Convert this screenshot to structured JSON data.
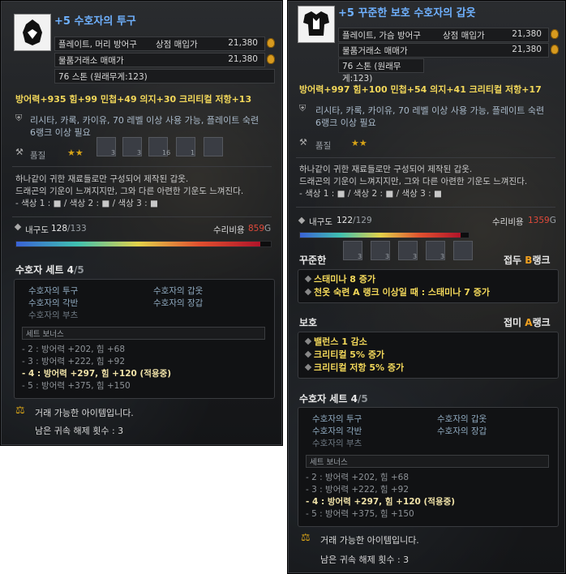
{
  "left": {
    "title": "+5 수호자의 투구",
    "rows": [
      {
        "label": "플레이트, 머리 방어구",
        "sub": "상점 매입가",
        "value": "21,380"
      },
      {
        "label": "물품거래소 매매가",
        "sub": "",
        "value": "21,380"
      },
      {
        "label": "76 스톤 (원래무게:123)",
        "sub": "",
        "value": ""
      }
    ],
    "stats": "방어력+935   힘+99   민첩+49   의지+30   크리티컬 저항+13",
    "req": [
      "리시타, 카록, 카이유, 70 레벨 이상 사용 가능, 플레이트 숙련",
      "6랭크 이상 필요"
    ],
    "quality_label": "품질",
    "stars": "★★",
    "slot_counts": [
      "3",
      "3",
      "16",
      "1"
    ],
    "desc": [
      "하나같이 귀한 재료들로만 구성되어 제작된 갑옷.",
      "드래곤의 기운이 느껴지지만, 그와 다른 아련한 기운도 느껴진다.",
      "- 색상 1 : ■  /  색상 2 : ■  /  색상 3 : ■"
    ],
    "durability_label": "내구도",
    "durability": "128",
    "durability_max": "/133",
    "durability_fraction": 0.96,
    "repair_label": "수리비용",
    "repair_value": "859",
    "repair_unit": "G",
    "set_title": "수호자 세트",
    "set_count": "4",
    "set_total": "/5",
    "set_items": [
      "수호자의 투구",
      "수호자의 갑옷",
      "수호자의 각반",
      "수호자의 장갑",
      "수호자의 부츠"
    ],
    "bonus_header": "세트 보너스",
    "bonuses": [
      "2 : 방어력 +202, 힘 +68",
      "3 : 방어력 +222, 힘 +92",
      "4 : 방어력 +297, 힘 +120 (적용중)",
      "5 : 방어력 +375, 힘 +150"
    ],
    "trade": "거래 가능한 아이템입니다.",
    "remain": "남은 귀속 해제 횟수 : 3"
  },
  "right": {
    "title": "+5 꾸준한 보호 수호자의 갑옷",
    "rows": [
      {
        "label": "플레이트, 가슴 방어구",
        "sub": "상점 매입가",
        "value": "21,380"
      },
      {
        "label": "물품거래소 매매가",
        "sub": "",
        "value": "21,380"
      },
      {
        "label": "76 스톤 (원래무게:123)",
        "sub": "",
        "value": ""
      }
    ],
    "stats": "방어력+997   힘+100   민첩+54   의지+41   크리티컬 저항+17",
    "req": [
      "리시타, 카록, 카이유, 70 레벨 이상 사용 가능, 플레이트 숙련",
      "6랭크 이상 필요"
    ],
    "quality_label": "품질",
    "stars": "★★",
    "slot_counts": [
      "3",
      "3",
      "3",
      "3"
    ],
    "desc": [
      "하나같이 귀한 재료들로만 구성되어 제작된 갑옷.",
      "드래곤의 기운이 느껴지지만, 그와 다른 아련한 기운도 느껴진다.",
      "- 색상 1 : ■  /  색상 2 : ■  /  색상 3 : ■"
    ],
    "durability_label": "내구도",
    "durability": "122",
    "durability_max": "/129",
    "durability_fraction": 0.95,
    "repair_label": "수리비용",
    "repair_value": "1359",
    "repair_unit": "G",
    "enchant1": {
      "title": "꾸준한",
      "grade_prefix": "접두",
      "grade": "B",
      "grade_suffix": "랭크",
      "lines": [
        "스태미나 8 증가",
        "천옷 숙련 A 랭크 이상일 때 : 스태미나 7 증가"
      ]
    },
    "enchant2": {
      "title": "보호",
      "grade_prefix": "접미",
      "grade": "A",
      "grade_suffix": "랭크",
      "lines": [
        "밸런스 1 감소",
        "크리티컬 5% 증가",
        "크리티컬 저항 5% 증가"
      ]
    },
    "set_title": "수호자 세트",
    "set_count": "4",
    "set_total": "/5",
    "set_items": [
      "수호자의 투구",
      "수호자의 갑옷",
      "수호자의 각반",
      "수호자의 장갑",
      "수호자의 부츠"
    ],
    "bonus_header": "세트 보너스",
    "bonuses": [
      "2 : 방어력 +202, 힘 +68",
      "3 : 방어력 +222, 힘 +92",
      "4 : 방어력 +297, 힘 +120 (적용중)",
      "5 : 방어력 +375, 힘 +150"
    ],
    "trade": "거래 가능한 아이템입니다.",
    "remain": "남은 귀속 해제 횟수 : 3"
  }
}
